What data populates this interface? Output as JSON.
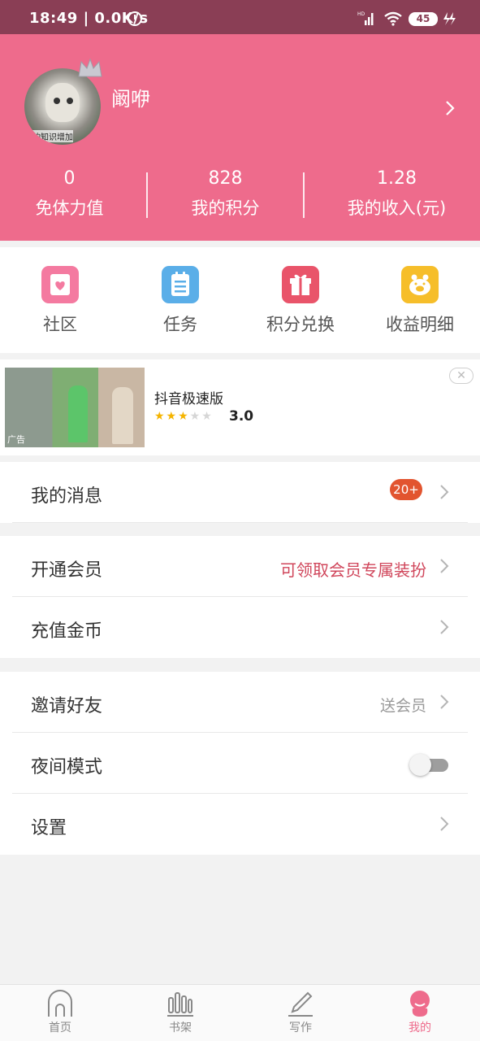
{
  "status_bar": {
    "time": "18:49 | 0.0K/s",
    "battery": "45",
    "signal_label": "HD"
  },
  "profile": {
    "username": "阚咿",
    "avatar_caption": "的知识增加"
  },
  "stats": [
    {
      "value": "0",
      "label": "免体力值"
    },
    {
      "value": "828",
      "label": "我的积分"
    },
    {
      "value": "1.28",
      "label": "我的收入(元)"
    }
  ],
  "shortcuts": [
    {
      "label": "社区",
      "icon": "heart-envelope-icon",
      "color": "#f47aa0"
    },
    {
      "label": "任务",
      "icon": "clipboard-icon",
      "color": "#5aaee8"
    },
    {
      "label": "积分兑换",
      "icon": "gift-icon",
      "color": "#e9546a"
    },
    {
      "label": "收益明细",
      "icon": "piggy-bank-icon",
      "color": "#f6be2a"
    }
  ],
  "ad": {
    "title": "抖音极速版",
    "rating": "3.0",
    "stars_filled": 3,
    "stars_total": 5,
    "tag": "广告"
  },
  "menu": {
    "messages": {
      "label": "我的消息",
      "badge": "20+"
    },
    "vip": {
      "label": "开通会员",
      "value": "可领取会员专属装扮"
    },
    "coins": {
      "label": "充值金币"
    },
    "invite": {
      "label": "邀请好友",
      "value": "送会员"
    },
    "night_mode": {
      "label": "夜间模式",
      "enabled": false
    },
    "settings": {
      "label": "设置"
    }
  },
  "bottom_nav": [
    {
      "label": "首页",
      "icon": "home-icon",
      "active": false
    },
    {
      "label": "书架",
      "icon": "bookshelf-icon",
      "active": false
    },
    {
      "label": "写作",
      "icon": "pen-icon",
      "active": false
    },
    {
      "label": "我的",
      "icon": "profile-icon",
      "active": true
    }
  ],
  "colors": {
    "header": "#ee6b8c",
    "status_bar": "#8a3e55",
    "accent_text": "#d0465b",
    "badge": "#e2542f"
  }
}
